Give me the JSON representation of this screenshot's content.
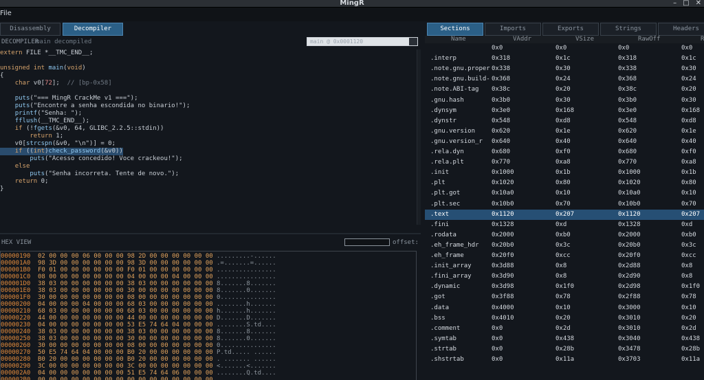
{
  "window": {
    "title": "MingR"
  },
  "menu": {
    "file": "File"
  },
  "left_tabs": [
    {
      "label": "Disassembly",
      "active": false
    },
    {
      "label": "Decompiler",
      "active": true
    }
  ],
  "decompiler": {
    "label": "DECOMPILER",
    "sub": "main decompiled",
    "combo_value": "main  @ 0x0001120",
    "lines": [
      "extern FILE *__TMC_END__;",
      "",
      "unsigned int main(void)",
      "{",
      "    char v0[72];  // [bp-0x58]",
      "",
      "    puts(\"=== MingR CrackMe v1 ===\");",
      "    puts(\"Encontre a senha escondida no binario!\");",
      "    printf(\"Senha: \");",
      "    fflush(__TMC_END__);",
      "    if (!fgets(&v0, 64, GLIBC_2.2.5::stdin))",
      "        return 1;",
      "    v0[strcspn(&v0, \"\\n\")] = 0;",
      "    if ((int)check_password(&v0))",
      "        puts(\"Acesso concedido! Voce crackeou!\");",
      "    else",
      "        puts(\"Senha incorreta. Tente de novo.\");",
      "    return 0;",
      "}"
    ]
  },
  "hex": {
    "label": "HEX VIEW",
    "offset_label": "offset:",
    "rows": [
      {
        "addr": "00000190",
        "bytes": "02 00 00 00 06 00 00 00 98 2D 00 00 00 00 00 00",
        "ascii": ".........-......"
      },
      {
        "addr": "000001A0",
        "bytes": "98 3D 00 00 00 00 00 00 98 3D 00 00 00 00 00 00",
        "ascii": ".=.......=......"
      },
      {
        "addr": "000001B0",
        "bytes": "F0 01 00 00 00 00 00 00 F0 01 00 00 00 00 00 00",
        "ascii": "................"
      },
      {
        "addr": "000001C0",
        "bytes": "08 00 00 00 00 00 00 00 04 00 00 00 04 00 00 00",
        "ascii": "................"
      },
      {
        "addr": "000001D0",
        "bytes": "38 03 00 00 00 00 00 00 38 03 00 00 00 00 00 00",
        "ascii": "8.......8......."
      },
      {
        "addr": "000001E0",
        "bytes": "38 03 00 00 00 00 00 00 30 00 00 00 00 00 00 00",
        "ascii": "8.......0......."
      },
      {
        "addr": "000001F0",
        "bytes": "30 00 00 00 00 00 00 00 08 00 00 00 00 00 00 00",
        "ascii": "0..............."
      },
      {
        "addr": "00000200",
        "bytes": "04 00 00 00 04 00 00 00 68 03 00 00 00 00 00 00",
        "ascii": "........h......."
      },
      {
        "addr": "00000210",
        "bytes": "68 03 00 00 00 00 00 00 68 03 00 00 00 00 00 00",
        "ascii": "h.......h......."
      },
      {
        "addr": "00000220",
        "bytes": "44 00 00 00 00 00 00 00 44 00 00 00 00 00 00 00",
        "ascii": "D.......D......."
      },
      {
        "addr": "00000230",
        "bytes": "04 00 00 00 00 00 00 00 53 E5 74 64 04 00 00 00",
        "ascii": "........S.td...."
      },
      {
        "addr": "00000240",
        "bytes": "38 03 00 00 00 00 00 00 38 03 00 00 00 00 00 00",
        "ascii": "8.......8......."
      },
      {
        "addr": "00000250",
        "bytes": "38 03 00 00 00 00 00 00 30 00 00 00 00 00 00 00",
        "ascii": "8.......0......."
      },
      {
        "addr": "00000260",
        "bytes": "30 00 00 00 00 00 00 00 08 00 00 00 00 00 00 00",
        "ascii": "0..............."
      },
      {
        "addr": "00000270",
        "bytes": "50 E5 74 64 04 00 00 00 B0 20 00 00 00 00 00 00",
        "ascii": "P.td..... ......"
      },
      {
        "addr": "00000280",
        "bytes": "B0 20 00 00 00 00 00 00 B0 20 00 00 00 00 00 00",
        "ascii": ". ....... ......"
      },
      {
        "addr": "00000290",
        "bytes": "3C 00 00 00 00 00 00 00 3C 00 00 00 00 00 00 00",
        "ascii": "<.......<......."
      },
      {
        "addr": "000002A0",
        "bytes": "04 00 00 00 00 00 00 00 51 E5 74 64 06 00 00 00",
        "ascii": "........Q.td...."
      },
      {
        "addr": "000002B0",
        "bytes": "00 00 00 00 00 00 00 00 00 00 00 00 00 00 00 00",
        "ascii": "................"
      }
    ]
  },
  "right_tabs": [
    {
      "label": "Sections",
      "active": true
    },
    {
      "label": "Imports",
      "active": false
    },
    {
      "label": "Exports",
      "active": false
    },
    {
      "label": "Strings",
      "active": false
    },
    {
      "label": "Headers",
      "active": false
    }
  ],
  "sections": {
    "columns": [
      "Name",
      "VAddr",
      "VSize",
      "RawOff",
      "R"
    ],
    "rows": [
      [
        "",
        "0x0",
        "0x0",
        "0x0",
        "0x0"
      ],
      [
        ".interp",
        "0x318",
        "0x1c",
        "0x318",
        "0x1c"
      ],
      [
        ".note.gnu.proper",
        "0x338",
        "0x30",
        "0x338",
        "0x30"
      ],
      [
        ".note.gnu.build-",
        "0x368",
        "0x24",
        "0x368",
        "0x24"
      ],
      [
        ".note.ABI-tag",
        "0x38c",
        "0x20",
        "0x38c",
        "0x20"
      ],
      [
        ".gnu.hash",
        "0x3b0",
        "0x30",
        "0x3b0",
        "0x30"
      ],
      [
        ".dynsym",
        "0x3e0",
        "0x168",
        "0x3e0",
        "0x168"
      ],
      [
        ".dynstr",
        "0x548",
        "0xd8",
        "0x548",
        "0xd8"
      ],
      [
        ".gnu.version",
        "0x620",
        "0x1e",
        "0x620",
        "0x1e"
      ],
      [
        ".gnu.version_r",
        "0x640",
        "0x40",
        "0x640",
        "0x40"
      ],
      [
        ".rela.dyn",
        "0x680",
        "0xf0",
        "0x680",
        "0xf0"
      ],
      [
        ".rela.plt",
        "0x770",
        "0xa8",
        "0x770",
        "0xa8"
      ],
      [
        ".init",
        "0x1000",
        "0x1b",
        "0x1000",
        "0x1b"
      ],
      [
        ".plt",
        "0x1020",
        "0x80",
        "0x1020",
        "0x80"
      ],
      [
        ".plt.got",
        "0x10a0",
        "0x10",
        "0x10a0",
        "0x10"
      ],
      [
        ".plt.sec",
        "0x10b0",
        "0x70",
        "0x10b0",
        "0x70"
      ],
      [
        ".text",
        "0x1120",
        "0x207",
        "0x1120",
        "0x207"
      ],
      [
        ".fini",
        "0x1328",
        "0xd",
        "0x1328",
        "0xd"
      ],
      [
        ".rodata",
        "0x2000",
        "0xb0",
        "0x2000",
        "0xb0"
      ],
      [
        ".eh_frame_hdr",
        "0x20b0",
        "0x3c",
        "0x20b0",
        "0x3c"
      ],
      [
        ".eh_frame",
        "0x20f0",
        "0xcc",
        "0x20f0",
        "0xcc"
      ],
      [
        ".init_array",
        "0x3d88",
        "0x8",
        "0x2d88",
        "0x8"
      ],
      [
        ".fini_array",
        "0x3d90",
        "0x8",
        "0x2d90",
        "0x8"
      ],
      [
        ".dynamic",
        "0x3d98",
        "0x1f0",
        "0x2d98",
        "0x1f0"
      ],
      [
        ".got",
        "0x3f88",
        "0x78",
        "0x2f88",
        "0x78"
      ],
      [
        ".data",
        "0x4000",
        "0x10",
        "0x3000",
        "0x10"
      ],
      [
        ".bss",
        "0x4010",
        "0x20",
        "0x3010",
        "0x20"
      ],
      [
        ".comment",
        "0x0",
        "0x2d",
        "0x3010",
        "0x2d"
      ],
      [
        ".symtab",
        "0x0",
        "0x438",
        "0x3040",
        "0x438"
      ],
      [
        ".strtab",
        "0x0",
        "0x28b",
        "0x3478",
        "0x28b"
      ],
      [
        ".shstrtab",
        "0x0",
        "0x11a",
        "0x3703",
        "0x11a"
      ]
    ],
    "selected_row": 16
  }
}
